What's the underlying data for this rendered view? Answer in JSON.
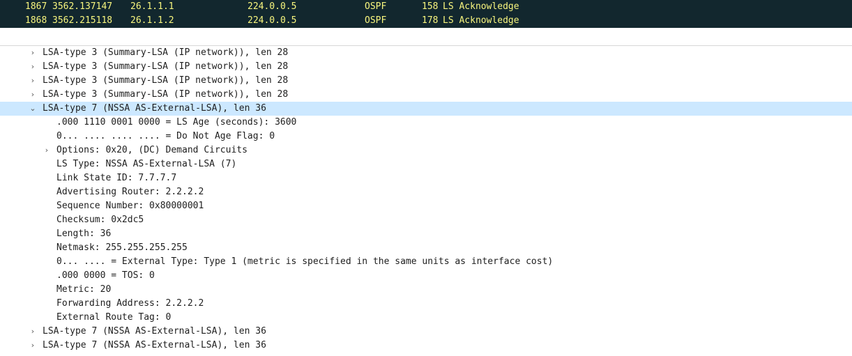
{
  "packet_list": {
    "rows": [
      {
        "no": "1867",
        "time": "3562.137147",
        "src": "26.1.1.1",
        "dst": "224.0.0.5",
        "proto": "OSPF",
        "len": "158",
        "info": "LS Acknowledge"
      },
      {
        "no": "1868",
        "time": "3562.215118",
        "src": "26.1.1.2",
        "dst": "224.0.0.5",
        "proto": "OSPF",
        "len": "178",
        "info": "LS Acknowledge"
      }
    ]
  },
  "detail_tree": {
    "rows": [
      {
        "text": "LSA-type 3 (Summary-LSA (IP network)), len 28",
        "arrow": "›",
        "level": 0,
        "selected": false
      },
      {
        "text": "LSA-type 3 (Summary-LSA (IP network)), len 28",
        "arrow": "›",
        "level": 0,
        "selected": false
      },
      {
        "text": "LSA-type 3 (Summary-LSA (IP network)), len 28",
        "arrow": "›",
        "level": 0,
        "selected": false
      },
      {
        "text": "LSA-type 3 (Summary-LSA (IP network)), len 28",
        "arrow": "›",
        "level": 0,
        "selected": false
      },
      {
        "text": "LSA-type 7 (NSSA AS-External-LSA), len 36",
        "arrow": "⌄",
        "level": 0,
        "selected": true
      },
      {
        "text": ".000 1110 0001 0000 = LS Age (seconds): 3600",
        "arrow": "",
        "level": 1,
        "selected": false
      },
      {
        "text": "0... .... .... .... = Do Not Age Flag: 0",
        "arrow": "",
        "level": 1,
        "selected": false
      },
      {
        "text": "Options: 0x20, (DC) Demand Circuits",
        "arrow": "›",
        "level": 1,
        "selected": false
      },
      {
        "text": "LS Type: NSSA AS-External-LSA (7)",
        "arrow": "",
        "level": 1,
        "selected": false
      },
      {
        "text": "Link State ID: 7.7.7.7",
        "arrow": "",
        "level": 1,
        "selected": false
      },
      {
        "text": "Advertising Router: 2.2.2.2",
        "arrow": "",
        "level": 1,
        "selected": false
      },
      {
        "text": "Sequence Number: 0x80000001",
        "arrow": "",
        "level": 1,
        "selected": false
      },
      {
        "text": "Checksum: 0x2dc5",
        "arrow": "",
        "level": 1,
        "selected": false
      },
      {
        "text": "Length: 36",
        "arrow": "",
        "level": 1,
        "selected": false
      },
      {
        "text": "Netmask: 255.255.255.255",
        "arrow": "",
        "level": 1,
        "selected": false
      },
      {
        "text": "0... .... = External Type: Type 1 (metric is specified in the same units as interface cost)",
        "arrow": "",
        "level": 1,
        "selected": false
      },
      {
        "text": ".000 0000 = TOS: 0",
        "arrow": "",
        "level": 1,
        "selected": false
      },
      {
        "text": "Metric: 20",
        "arrow": "",
        "level": 1,
        "selected": false
      },
      {
        "text": "Forwarding Address: 2.2.2.2",
        "arrow": "",
        "level": 1,
        "selected": false
      },
      {
        "text": "External Route Tag: 0",
        "arrow": "",
        "level": 1,
        "selected": false
      },
      {
        "text": "LSA-type 7 (NSSA AS-External-LSA), len 36",
        "arrow": "›",
        "level": 0,
        "selected": false
      },
      {
        "text": "LSA-type 7 (NSSA AS-External-LSA), len 36",
        "arrow": "›",
        "level": 0,
        "selected": false
      }
    ]
  },
  "colors": {
    "packet_bg": "#12272e",
    "packet_fg": "#f7f57e",
    "selected_bg": "#cce8ff"
  }
}
